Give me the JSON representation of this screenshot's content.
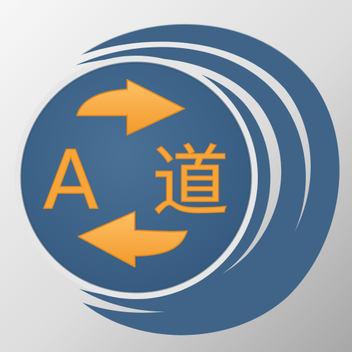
{
  "icon": {
    "name": "translator-app-icon",
    "source_letter": "A",
    "target_glyph": "道",
    "colors": {
      "background_light": "#f4f4f4",
      "background_dark": "#a9a9a9",
      "disc": "#3e6387",
      "disc_edge": "#2f4f70",
      "accent_orange": "#f7a43a",
      "accent_orange_dark": "#e08a20",
      "ring_highlight": "#d9d9d9"
    },
    "icons": [
      "arrow-right-icon",
      "arrow-left-icon",
      "wave-rings-icon"
    ]
  }
}
